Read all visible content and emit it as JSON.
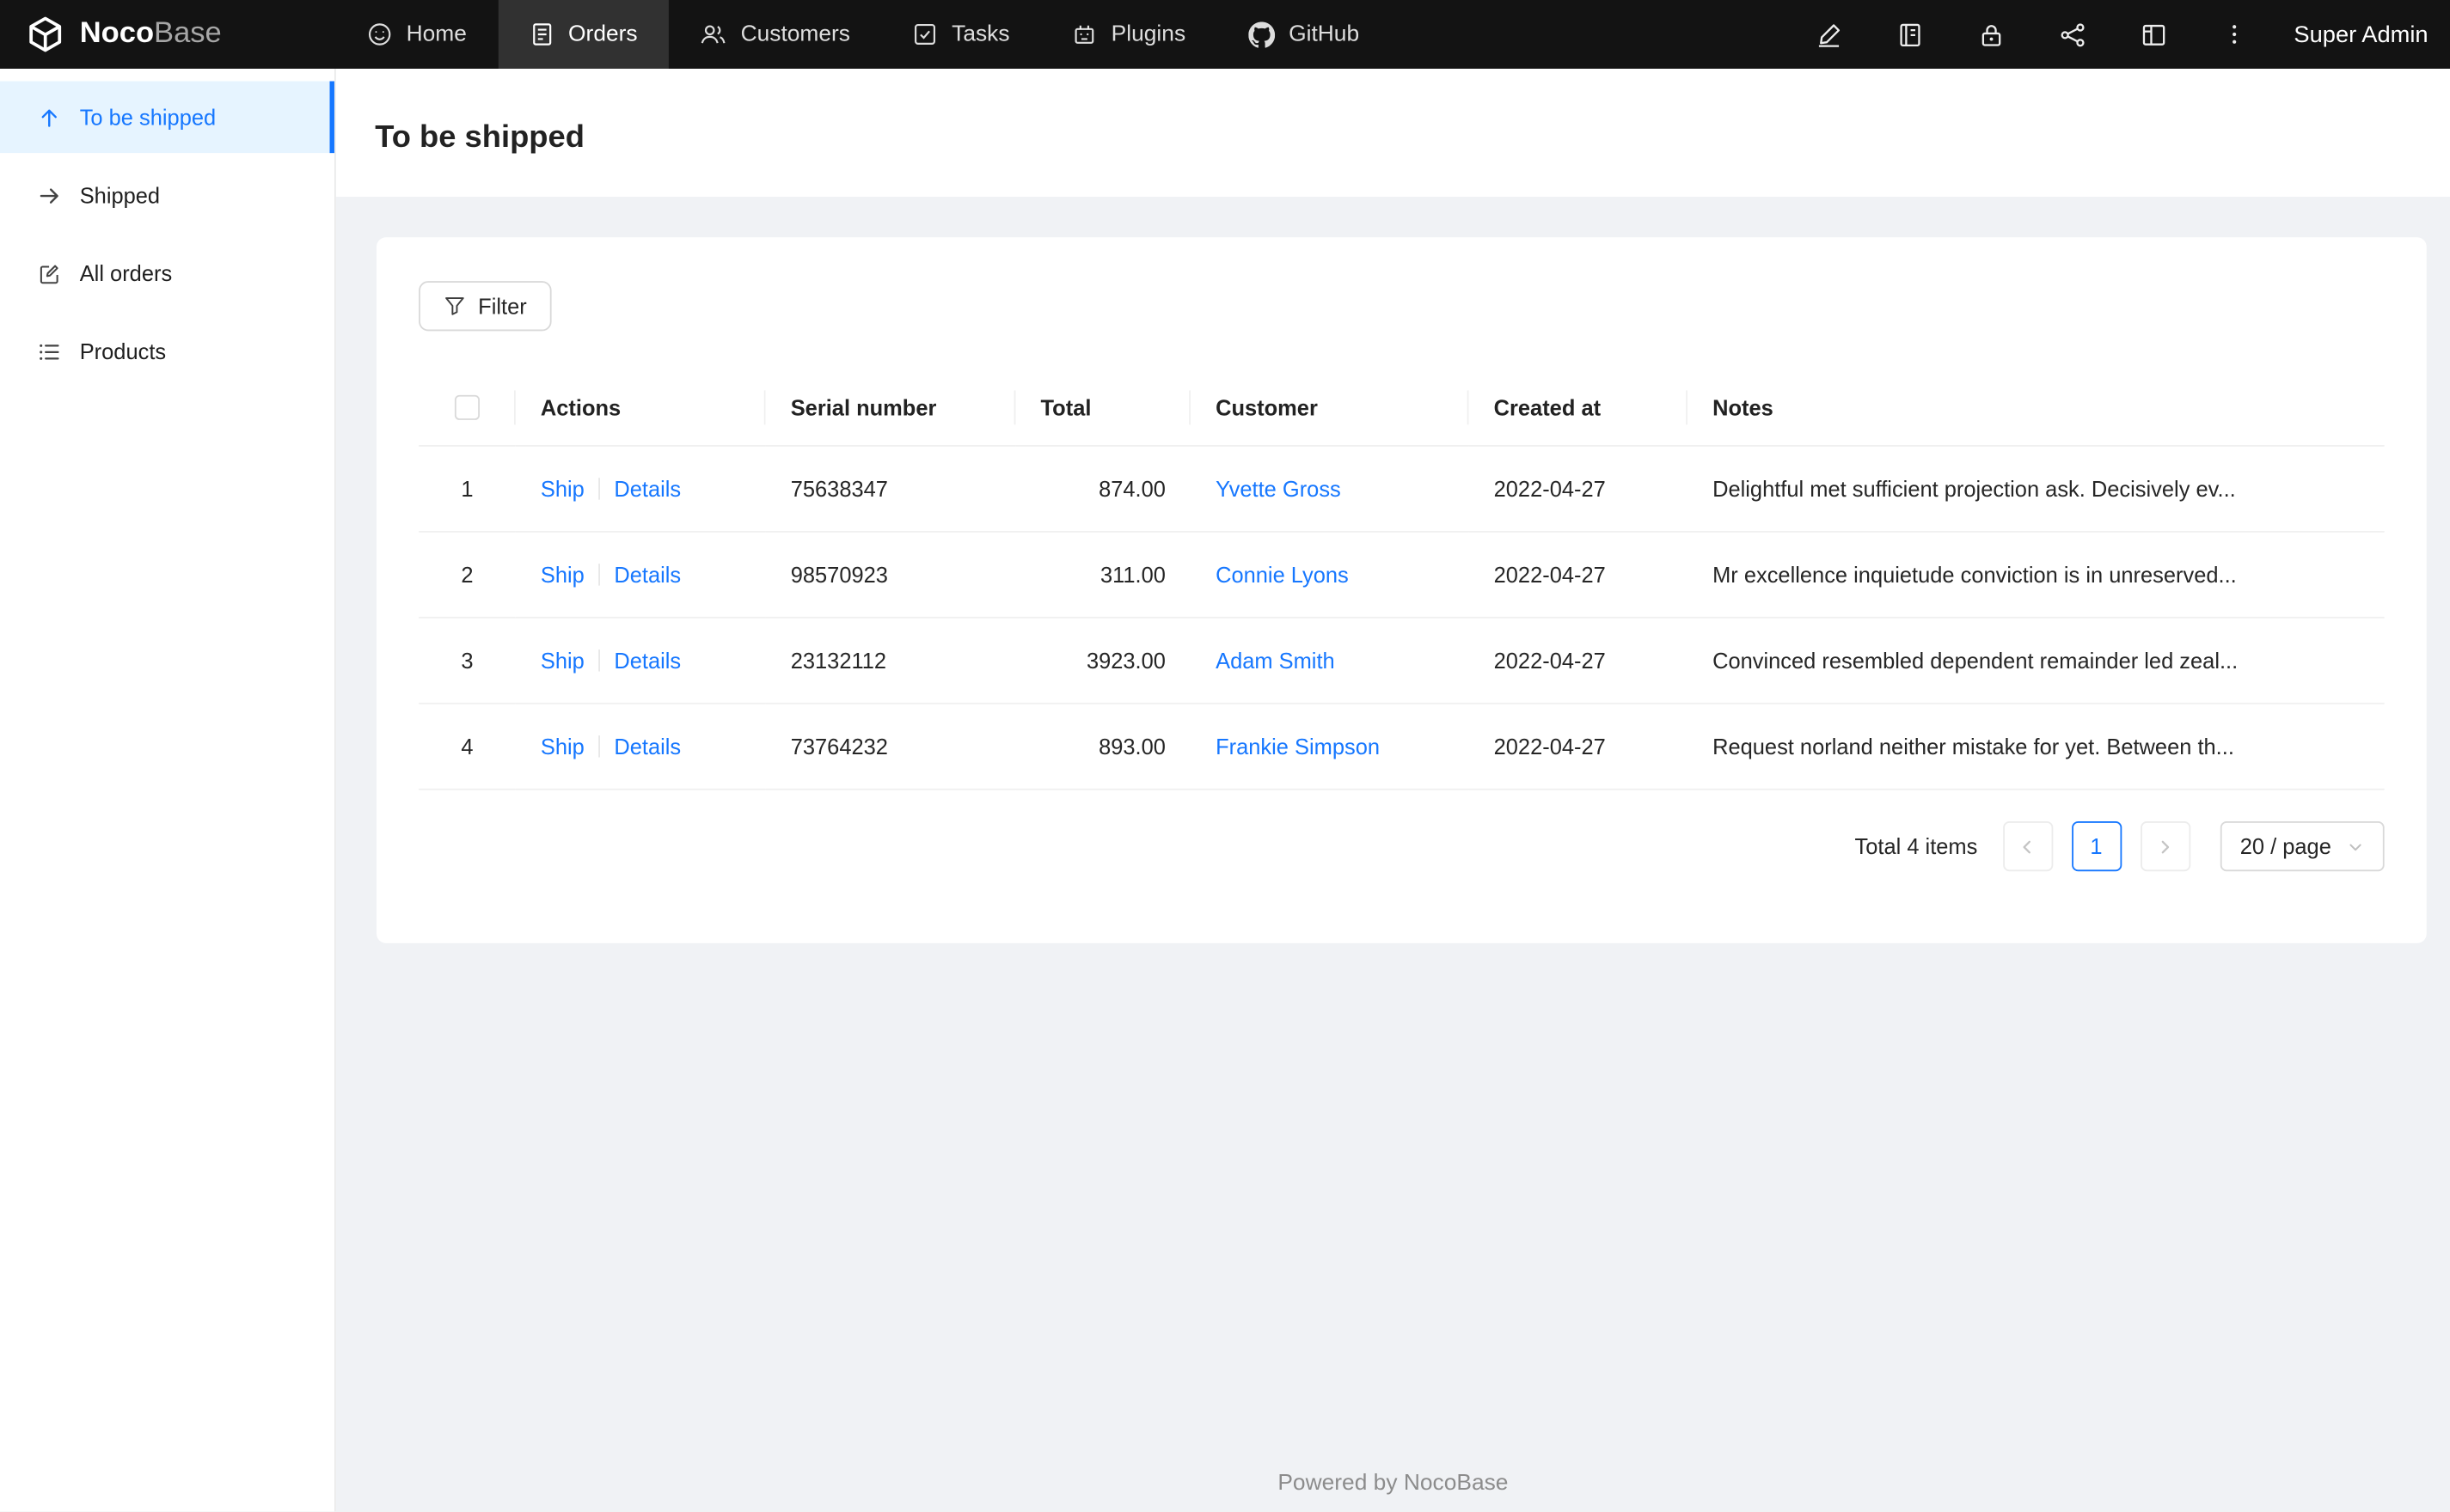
{
  "colors": {
    "primary": "#1677ff",
    "navbar_bg": "#131313",
    "sidebar_active_bg": "#e6f4ff",
    "link": "#1677ff",
    "content_bg": "#f0f2f5"
  },
  "navbar": {
    "logo_noco": "Noco",
    "logo_base": "Base",
    "items": [
      {
        "label": "Home",
        "icon": "smile-icon"
      },
      {
        "label": "Orders",
        "icon": "orders-file-icon",
        "active": true
      },
      {
        "label": "Customers",
        "icon": "team-icon"
      },
      {
        "label": "Tasks",
        "icon": "check-square-icon"
      },
      {
        "label": "Plugins",
        "icon": "robot-icon"
      },
      {
        "label": "GitHub",
        "icon": "github-icon"
      }
    ],
    "right_icons": [
      "highlighter-icon",
      "notebook-icon",
      "lock-icon",
      "api-network-icon",
      "layout-icon",
      "ellipsis-vertical-icon"
    ],
    "user": "Super Admin"
  },
  "sidebar": {
    "items": [
      {
        "label": "To be shipped",
        "icon": "arrow-up-icon",
        "active": true
      },
      {
        "label": "Shipped",
        "icon": "arrow-right-icon"
      },
      {
        "label": "All orders",
        "icon": "form-file-icon"
      },
      {
        "label": "Products",
        "icon": "unordered-list-icon"
      }
    ]
  },
  "page": {
    "title": "To be shipped"
  },
  "toolbar": {
    "filter_label": "Filter"
  },
  "table": {
    "columns": [
      "Actions",
      "Serial number",
      "Total",
      "Customer",
      "Created at",
      "Notes"
    ],
    "rows": [
      {
        "index": "1",
        "ship": "Ship",
        "details": "Details",
        "serial": "75638347",
        "total": "874.00",
        "customer": "Yvette Gross",
        "created_at": "2022-04-27",
        "notes": "Delightful met sufficient projection ask. Decisively ev..."
      },
      {
        "index": "2",
        "ship": "Ship",
        "details": "Details",
        "serial": "98570923",
        "total": "311.00",
        "customer": "Connie Lyons",
        "created_at": "2022-04-27",
        "notes": "Mr excellence inquietude conviction is in unreserved..."
      },
      {
        "index": "3",
        "ship": "Ship",
        "details": "Details",
        "serial": "23132112",
        "total": "3923.00",
        "customer": "Adam Smith",
        "created_at": "2022-04-27",
        "notes": "Convinced resembled dependent remainder led zeal..."
      },
      {
        "index": "4",
        "ship": "Ship",
        "details": "Details",
        "serial": "73764232",
        "total": "893.00",
        "customer": "Frankie Simpson",
        "created_at": "2022-04-27",
        "notes": "Request norland neither mistake for yet. Between th..."
      }
    ]
  },
  "pagination": {
    "total_text": "Total 4 items",
    "current_page": "1",
    "page_size": "20 / page"
  },
  "footer": {
    "text": "Powered by NocoBase"
  }
}
